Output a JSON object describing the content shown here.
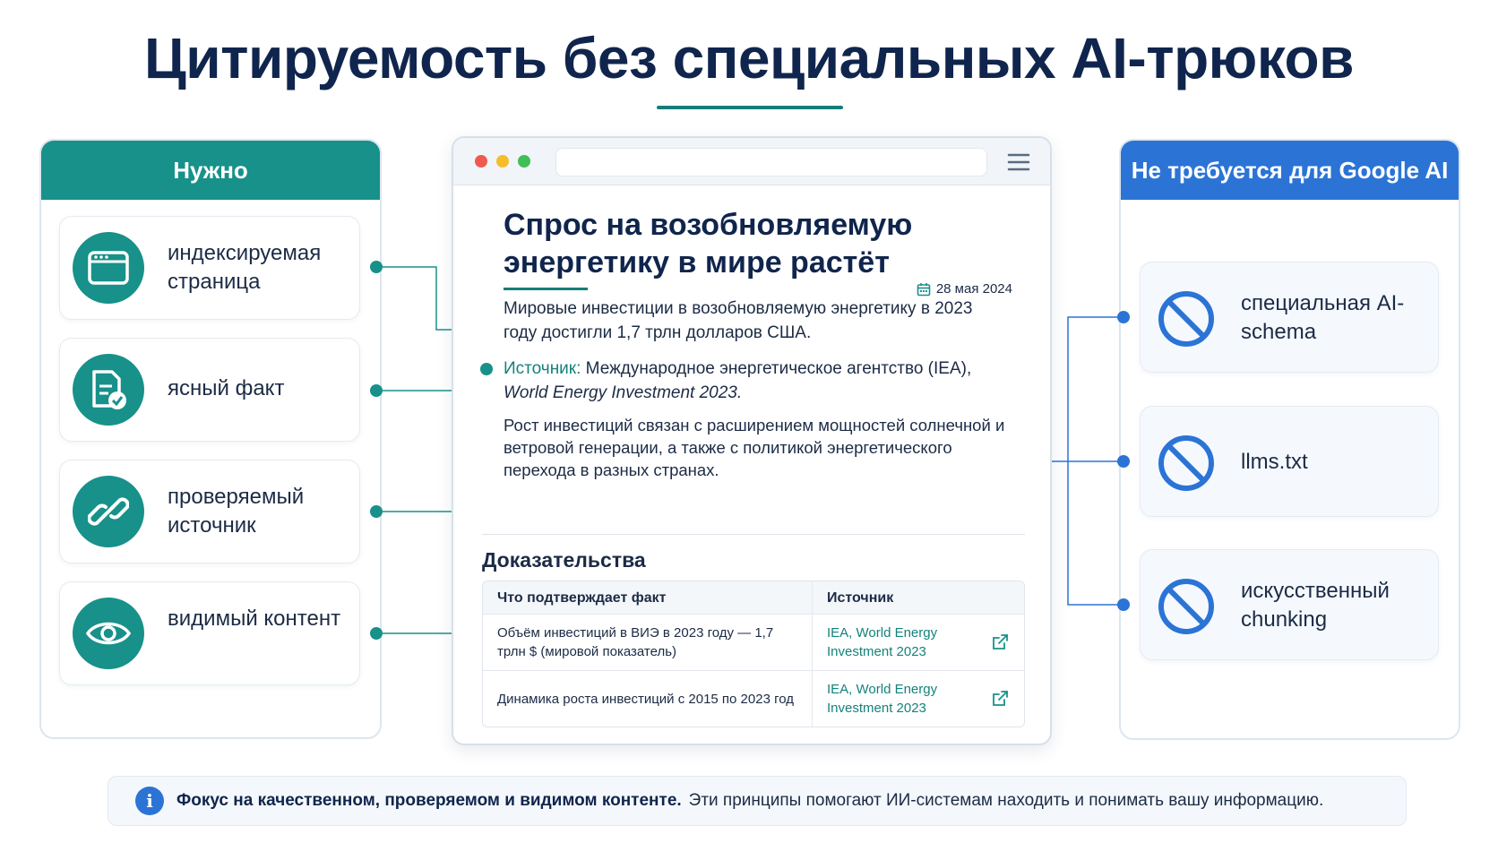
{
  "title": "Цитируемость без специальных AI-трюков",
  "left_panel": {
    "header": "Нужно",
    "items": [
      {
        "label": "индексируемая страница",
        "icon": "browser-window-icon"
      },
      {
        "label": "ясный факт",
        "icon": "document-check-icon"
      },
      {
        "label": "проверяемый источник",
        "icon": "link-icon"
      },
      {
        "label": "видимый контент",
        "icon": "eye-icon"
      }
    ]
  },
  "right_panel": {
    "header": "Не требуется для Google AI",
    "items": [
      {
        "label": "специальная AI-schema",
        "icon": "prohibited-icon"
      },
      {
        "label": "llms.txt",
        "icon": "prohibited-icon"
      },
      {
        "label": "искусственный chunking",
        "icon": "prohibited-icon"
      }
    ]
  },
  "article": {
    "title": "Спрос на возобновляемую энергетику в мире растёт",
    "date": "28 мая 2024",
    "paragraph1": "Мировые инвестиции в возобновляемую энергетику в 2023 году достигли 1,7 трлн долларов США.",
    "source_label": "Источник:",
    "source_text": "Международное энергетическое агентство (IEA),",
    "source_italic": "World Energy Investment 2023.",
    "paragraph2": "Рост инвестиций связан с расширением мощностей солнечной и ветровой генерации, а также с политикой энергетического перехода в разных странах.",
    "evidence_title": "Доказательства",
    "table": {
      "headers": [
        "Что подтверждает факт",
        "Источник"
      ],
      "rows": [
        {
          "fact": "Объём инвестиций в ВИЭ в 2023 году — 1,7 трлн $ (мировой показатель)",
          "source": "IEA, World Energy Investment 2023"
        },
        {
          "fact": "Динамика роста инвестиций с 2015 по 2023 год",
          "source": "IEA, World Energy Investment 2023"
        }
      ]
    }
  },
  "footer": {
    "strong": "Фокус на качественном, проверяемом и видимом контенте.",
    "text": "Эти принципы помогают ИИ-системам находить и понимать вашу информацию."
  },
  "colors": {
    "teal": "#17918a",
    "blue": "#2b74d6",
    "navy": "#10254d"
  }
}
